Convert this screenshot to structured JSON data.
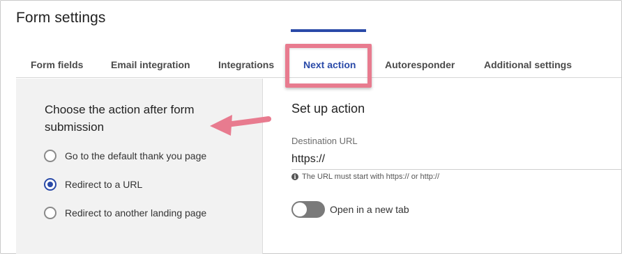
{
  "page": {
    "title": "Form settings"
  },
  "tabs": [
    {
      "label": "Form fields"
    },
    {
      "label": "Email integration"
    },
    {
      "label": "Integrations"
    },
    {
      "label": "Next action",
      "active": true
    },
    {
      "label": "Autoresponder"
    },
    {
      "label": "Additional settings"
    }
  ],
  "left": {
    "heading": "Choose the action after form submission",
    "options": [
      {
        "label": "Go to the default thank you page",
        "checked": false
      },
      {
        "label": "Redirect to a URL",
        "checked": true
      },
      {
        "label": "Redirect to another landing page",
        "checked": false
      }
    ]
  },
  "right": {
    "heading": "Set up action",
    "destination": {
      "label": "Destination URL",
      "value": "https://",
      "helper": "The URL must start with https:// or http://"
    },
    "toggle": {
      "label": "Open in a new tab",
      "on": false
    }
  },
  "colors": {
    "accent": "#2a4aa8",
    "highlight": "#e87b8f",
    "panel": "#f2f2f2"
  },
  "icons": {
    "info": "info-icon",
    "annotation": "arrow-icon"
  }
}
